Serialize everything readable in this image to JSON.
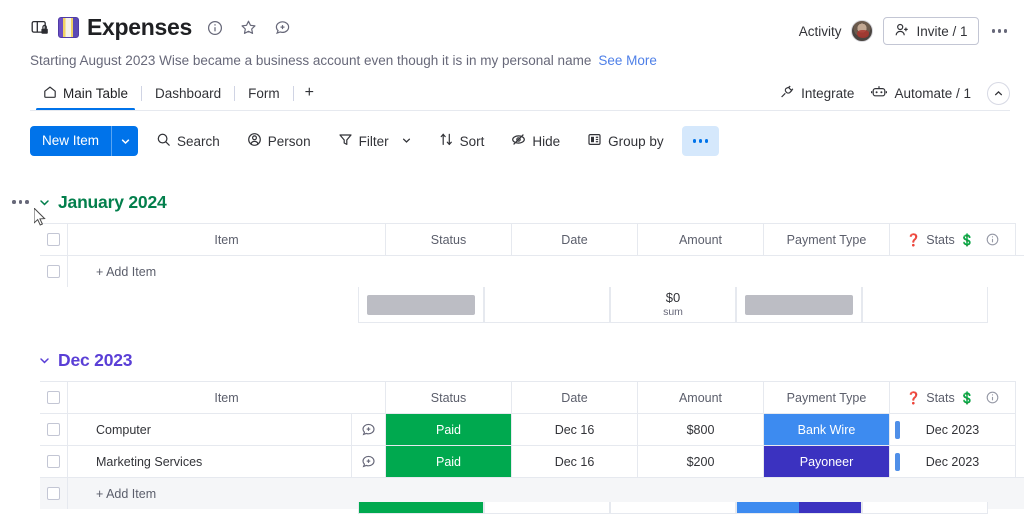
{
  "header": {
    "board_title": "Expenses",
    "private_icon": "private-board-icon",
    "board_emoji": "book-emoji",
    "info_icon": "info-icon",
    "favorite_icon": "star-icon",
    "update_icon": "add-update-icon",
    "activity_label": "Activity",
    "avatar": "user-avatar",
    "invite_label": "Invite / 1",
    "invite_icon": "add-person-icon",
    "more_icon": "more-options-icon",
    "subtitle": "Starting August 2023 Wise became a business account even though it is in my personal name",
    "see_more": "See More"
  },
  "tabs": {
    "items": [
      {
        "label": "Main Table",
        "icon": "home-icon",
        "active": true
      },
      {
        "label": "Dashboard",
        "icon": "",
        "active": false
      },
      {
        "label": "Form",
        "icon": "",
        "active": false
      }
    ],
    "add_label": "+",
    "right": [
      {
        "label": "Integrate",
        "icon": "integrate-icon"
      },
      {
        "label": "Automate / 1",
        "icon": "robot-icon"
      }
    ],
    "collapse_icon": "chevron-up-icon"
  },
  "toolbar": {
    "new_item_label": "New Item",
    "new_item_caret": "chevron-down-icon",
    "items": [
      {
        "label": "Search",
        "icon": "search-icon",
        "caret": false,
        "highlight": false
      },
      {
        "label": "Person",
        "icon": "person-icon",
        "caret": false,
        "highlight": false
      },
      {
        "label": "Filter",
        "icon": "filter-icon",
        "caret": true,
        "highlight": false
      },
      {
        "label": "Sort",
        "icon": "sort-icon",
        "caret": false,
        "highlight": false
      },
      {
        "label": "Hide",
        "icon": "eye-off-icon",
        "caret": false,
        "highlight": false
      },
      {
        "label": "Group by",
        "icon": "group-by-icon",
        "caret": false,
        "highlight": false
      }
    ],
    "more_label": "more-options",
    "more_highlight": true
  },
  "columns": {
    "item": "Item",
    "status": "Status",
    "date": "Date",
    "amount": "Amount",
    "payment_type": "Payment Type",
    "stats": "Stats",
    "stats_prefix_icon": "question-mark-emoji",
    "stats_suffix_icon": "dollar-emoji",
    "stats_info_icon": "info-icon"
  },
  "add_item_label": "+ Add Item",
  "groups": [
    {
      "title": "January 2024",
      "color": "#037f4c",
      "caret": "chevron-down-icon",
      "menu_icon": "group-menu-icon",
      "rows": [],
      "summary": {
        "status": {
          "type": "placeholder"
        },
        "date": {
          "type": "empty"
        },
        "amount": {
          "type": "value",
          "main": "$0",
          "sub": "sum"
        },
        "payment_type": {
          "type": "placeholder"
        },
        "stats": {
          "type": "empty"
        }
      }
    },
    {
      "title": "Dec 2023",
      "color": "#5a3fd6",
      "caret": "chevron-down-icon",
      "menu_icon": "",
      "rows": [
        {
          "item": "Computer",
          "status": "Paid",
          "status_color": "#00a94f",
          "date": "Dec 16",
          "amount": "$800",
          "payment_type": "Bank Wire",
          "payment_color": "#3d8bf0",
          "stats": "Dec 2023",
          "stats_bar_color": "#4f8fe8"
        },
        {
          "item": "Marketing Services",
          "status": "Paid",
          "status_color": "#00a94f",
          "date": "Dec 16",
          "amount": "$200",
          "payment_type": "Payoneer",
          "payment_color": "#3b32c0",
          "stats": "Dec 2023",
          "stats_bar_color": "#4f8fe8"
        }
      ],
      "summary": null
    }
  ],
  "colors": {
    "primary": "#0073ea",
    "green": "#00a94f",
    "group_green": "#037f4c",
    "group_purple": "#5a3fd6",
    "link": "#4f80e8"
  }
}
